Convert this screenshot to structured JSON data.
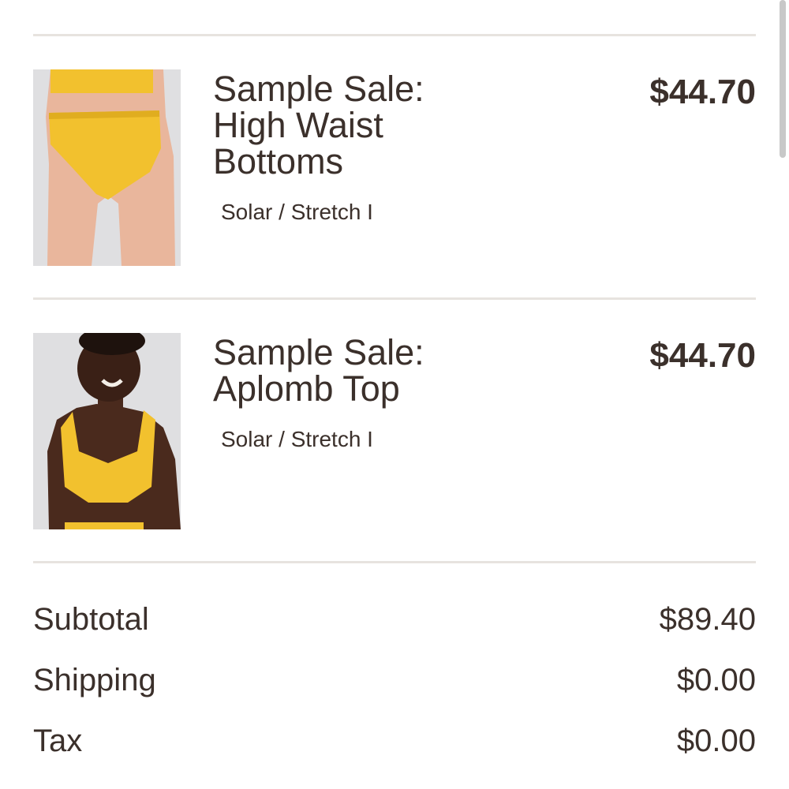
{
  "cart": {
    "items": [
      {
        "title_line1": "Sample Sale:",
        "title_line2": "High Waist",
        "title_line3": "Bottoms",
        "variant": "Solar / Stretch I",
        "price": "$44.70",
        "image_icon": "bikini-bottoms-product-image"
      },
      {
        "title_line1": "Sample Sale:",
        "title_line2": "Aplomb Top",
        "variant": "Solar / Stretch I",
        "price": "$44.70",
        "image_icon": "bikini-top-product-image"
      }
    ]
  },
  "summary": {
    "subtotal_label": "Subtotal",
    "subtotal_value": "$89.40",
    "shipping_label": "Shipping",
    "shipping_value": "$0.00",
    "tax_label": "Tax",
    "tax_value": "$0.00"
  },
  "colors": {
    "text": "#3b302b",
    "divider": "#e7e3df",
    "swimwear": "#f2c12e",
    "thumb_background": "#dfdfe1"
  }
}
